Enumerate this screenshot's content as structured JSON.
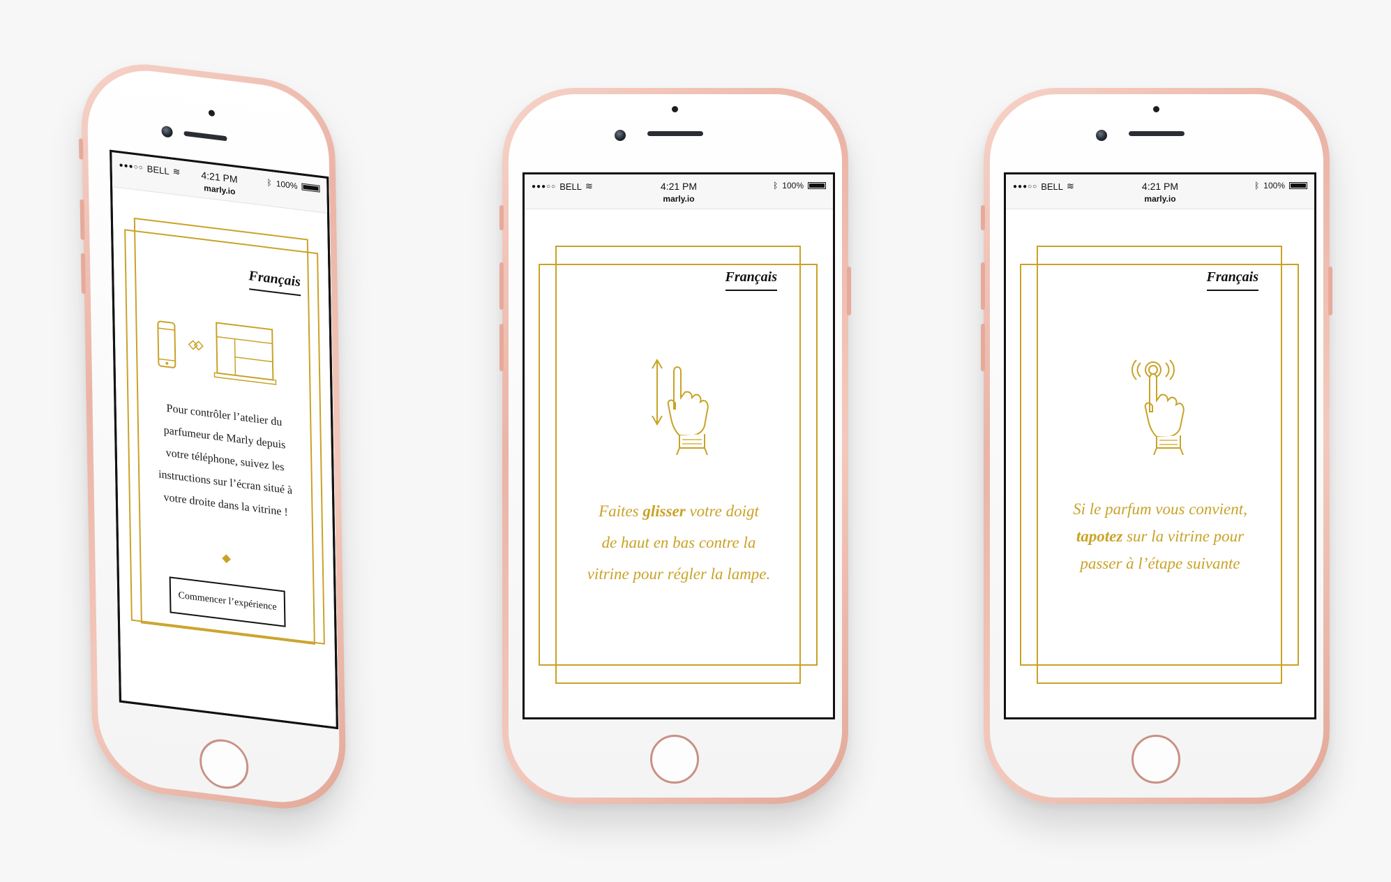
{
  "colors": {
    "gold": "#c9a227",
    "rose_gold": "#eab4a6",
    "ink": "#111111"
  },
  "statusbar": {
    "carrier": "BELL",
    "time": "4:21 PM",
    "url": "marly.io",
    "battery": "100%"
  },
  "phones": [
    {
      "language_link": "Français",
      "intro_lines": [
        "Pour contrôler l’atelier du",
        "parfumeur de Marly depuis",
        "votre téléphone, suivez les",
        "instructions sur l’écran situé à",
        "votre droite dans la vitrine !"
      ],
      "start_button": "Commencer l’expérience",
      "icon": "phone-to-window-icon"
    },
    {
      "language_link": "Français",
      "line1_pre": "Faites ",
      "line1_bold": "glisser",
      "line1_post": " votre doigt",
      "line2": "de haut en bas contre la",
      "line3": "vitrine pour régler la lampe.",
      "icon": "swipe-vertical-hand-icon"
    },
    {
      "language_link": "Français",
      "line1": "Si le parfum vous convient,",
      "line2_bold": "tapotez",
      "line2_post": " sur la vitrine pour",
      "line3": "passer à l’étape suivante",
      "icon": "tap-hand-icon"
    }
  ]
}
